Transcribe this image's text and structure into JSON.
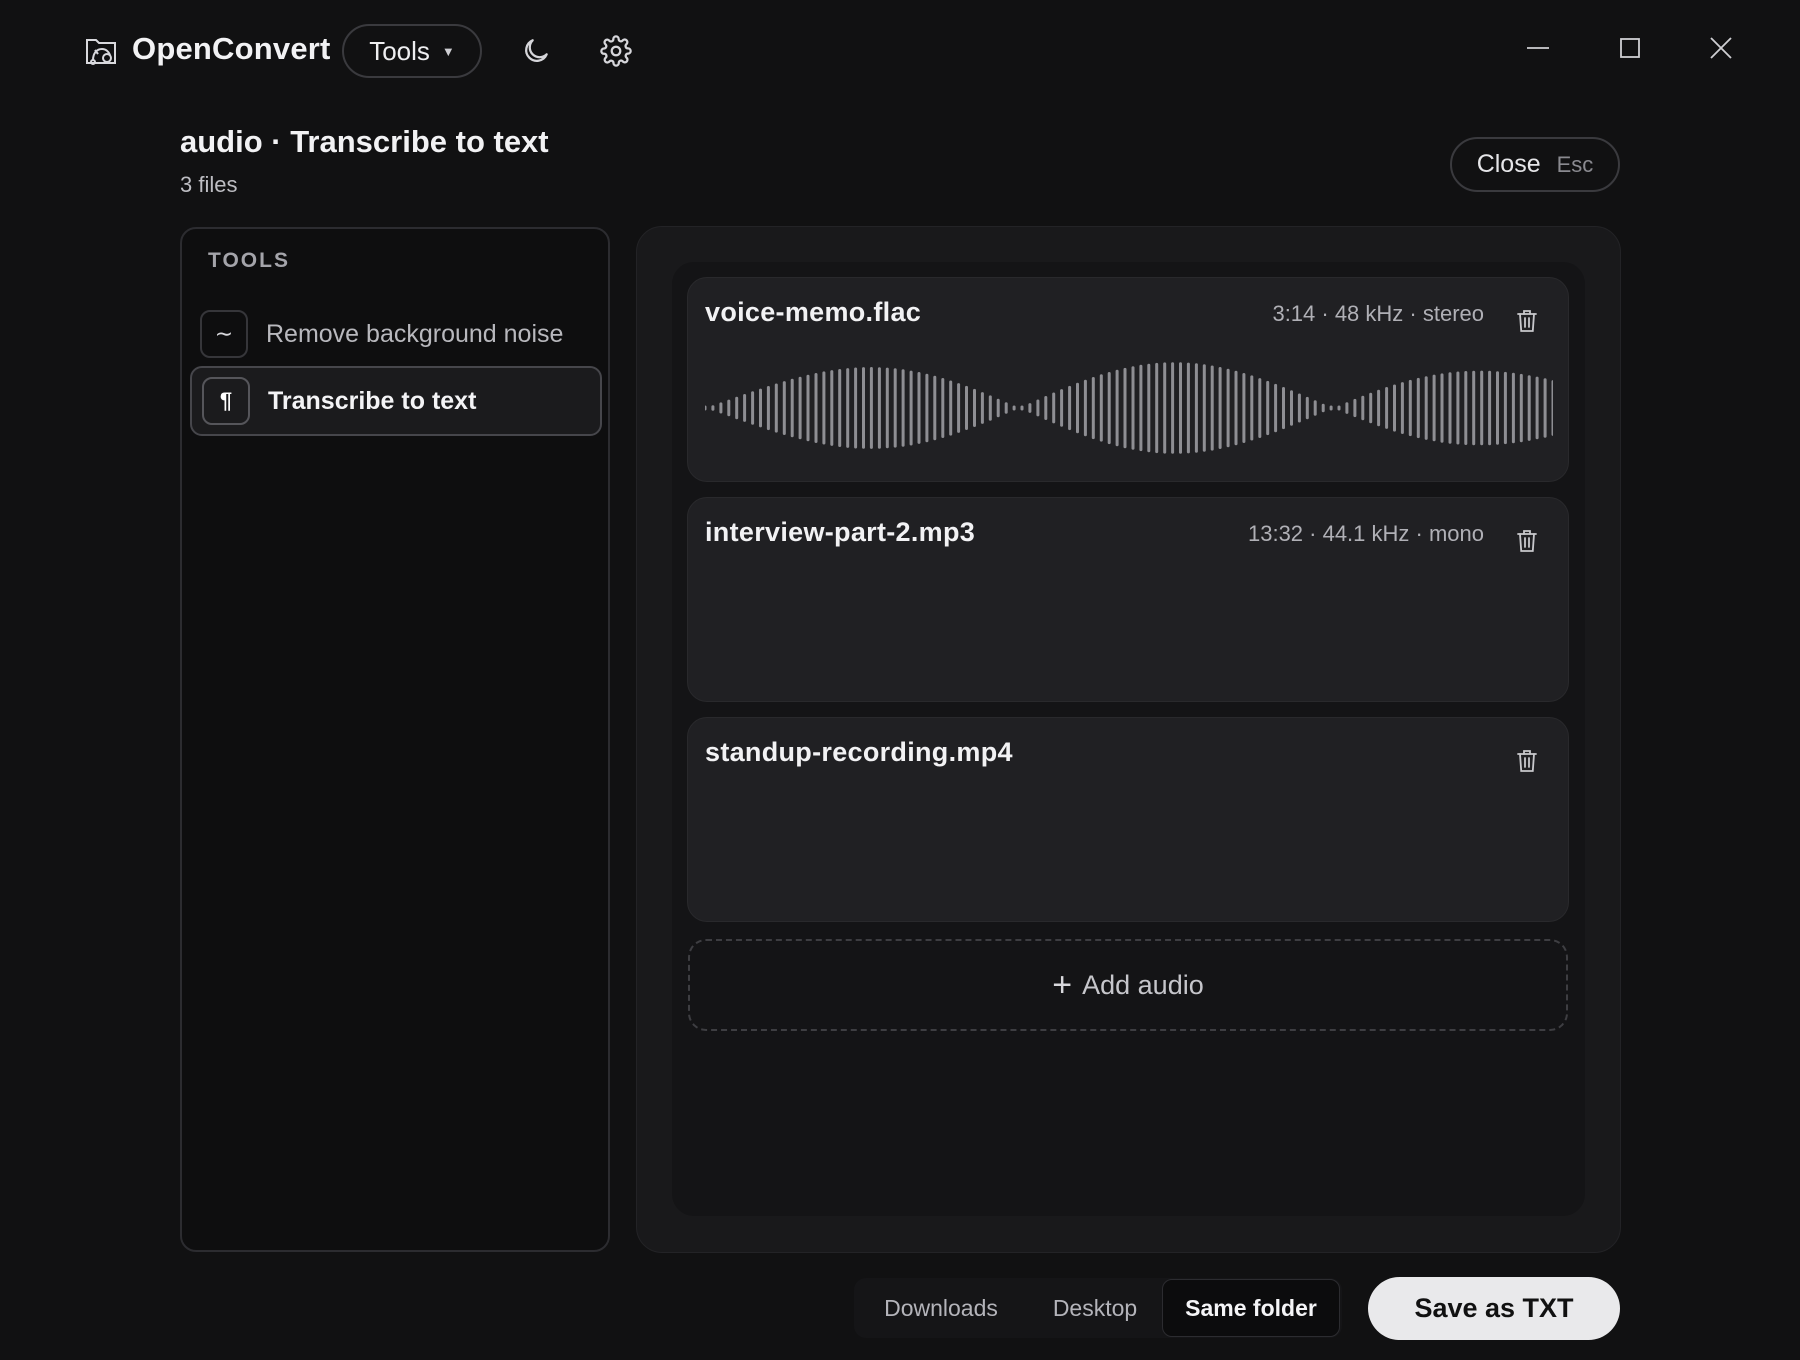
{
  "app": {
    "name": "OpenConvert",
    "tools_menu_label": "Tools",
    "icons": [
      "app-logo-icon",
      "caret-down-icon",
      "moon-icon",
      "gear-icon",
      "minimize-icon",
      "maximize-icon",
      "close-icon"
    ]
  },
  "header": {
    "title": "audio · Transcribe to text",
    "subtitle": "3 files",
    "close_label": "Close",
    "close_shortcut": "Esc"
  },
  "tools_panel": {
    "heading": "TOOLS",
    "items": [
      {
        "label": "Remove background noise",
        "glyph": "∼",
        "icon": "wave-tilde-icon",
        "active": false
      },
      {
        "label": "Transcribe to text",
        "glyph": "¶",
        "icon": "pilcrow-icon",
        "active": true
      }
    ]
  },
  "files": [
    {
      "name": "voice-memo.flac",
      "meta": "3:14 · 48 kHz · stereo",
      "has_waveform": true
    },
    {
      "name": "interview-part-2.mp3",
      "meta": "13:32 · 44.1 kHz · mono",
      "has_waveform": false
    },
    {
      "name": "standup-recording.mp4",
      "meta": "",
      "has_waveform": false
    }
  ],
  "add_audio_label": "Add audio",
  "destinations": {
    "options": [
      "Downloads",
      "Desktop",
      "Same folder"
    ],
    "selected": "Same folder"
  },
  "save_button_label": "Save as TXT",
  "colors": {
    "background": "#111112",
    "waveform": "#8e8e93",
    "primary_button": "#e9e9eb"
  }
}
